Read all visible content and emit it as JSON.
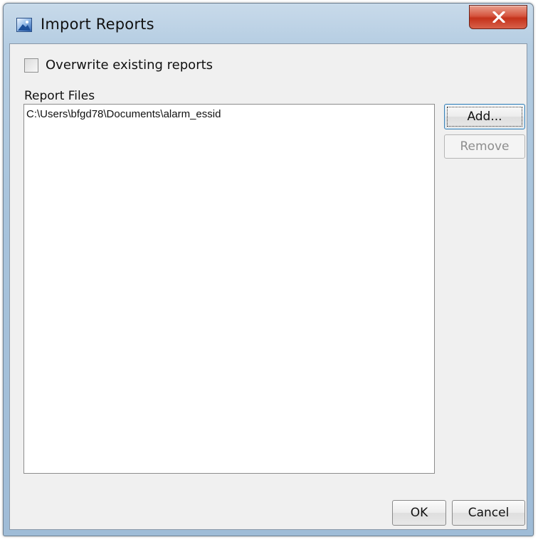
{
  "window": {
    "title": "Import Reports",
    "icon": "import-reports-icon",
    "close_icon": "close-x-icon"
  },
  "options": {
    "overwrite_label": "Overwrite existing reports",
    "overwrite_checked": false
  },
  "report_files": {
    "label": "Report Files",
    "items": [
      "C:\\Users\\bfgd78\\Documents\\alarm_essid"
    ]
  },
  "buttons": {
    "add": "Add...",
    "remove": "Remove",
    "ok": "OK",
    "cancel": "Cancel"
  },
  "colors": {
    "close_button": "#c9391f",
    "title_bar": "#a7c3dc",
    "dialog_background": "#f0f0f0"
  }
}
